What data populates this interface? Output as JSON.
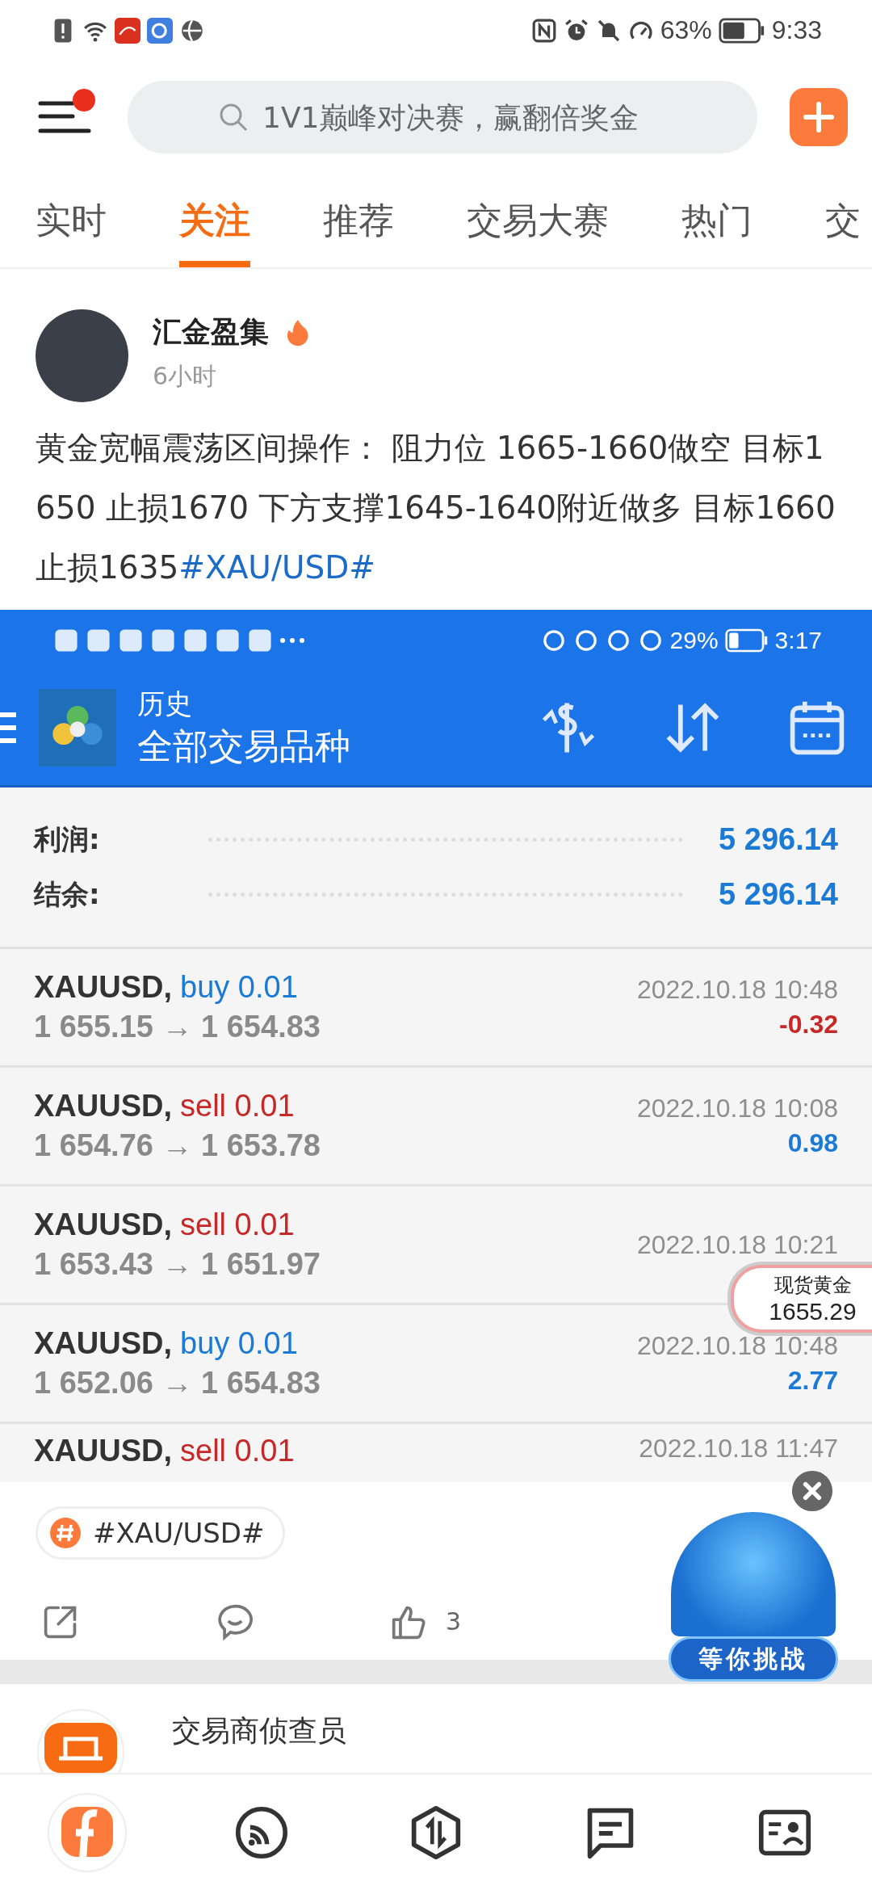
{
  "status_bar": {
    "battery": "63%",
    "time": "9:33"
  },
  "header": {
    "menu_badge": true,
    "search": {
      "placeholder": "1V1巅峰对决赛，赢翻倍奖金"
    }
  },
  "tabs": [
    {
      "label": "实时",
      "selected": false
    },
    {
      "label": "关注",
      "selected": true
    },
    {
      "label": "推荐",
      "selected": false
    },
    {
      "label": "交易大赛",
      "selected": false
    },
    {
      "label": "热门",
      "selected": false
    },
    {
      "label": "交",
      "selected": false
    }
  ],
  "post": {
    "author": "汇金盈集",
    "time": "6小时",
    "text": "黄金宽幅震荡区间操作： 阻力位 1665-1660做空 目标1650 止损1670 下方支撑1645-1640附近做多 目标1660 止损1635",
    "hashtag": "#XAU/USD#",
    "screenshot": {
      "status_bar": {
        "battery": "29%",
        "time": "3:17"
      },
      "toolbar": {
        "title": "历史",
        "subtitle": "全部交易品种"
      },
      "summary": [
        {
          "label": "利润:",
          "value": "5 296.14"
        },
        {
          "label": "结余:",
          "value": "5 296.14"
        }
      ],
      "trades": [
        {
          "symbol": "XAUUSD,",
          "kind": "buy",
          "order": "buy 0.01",
          "prices": "1 655.15 → 1 654.83",
          "time": "2022.10.18 10:48",
          "profit": "-0.32",
          "color": "#c62828"
        },
        {
          "symbol": "XAUUSD,",
          "kind": "sell",
          "order": "sell 0.01",
          "prices": "1 654.76 → 1 653.78",
          "time": "2022.10.18 10:08",
          "profit": "0.98",
          "color": "#1a7ad6"
        },
        {
          "symbol": "XAUUSD,",
          "kind": "sell",
          "order": "sell 0.01",
          "prices": "1 653.43 → 1 651.97",
          "time": "2022.10.18 10:21"
        },
        {
          "symbol": "XAUUSD,",
          "kind": "buy",
          "order": "buy 0.01",
          "prices": "1 652.06 → 1 654.83",
          "time": "2022.10.18 10:48",
          "profit": "2.77",
          "color": "#1a7ad6"
        },
        {
          "symbol": "XAUUSD,",
          "kind": "sell",
          "order": "sell 0.01",
          "time": "2022.10.18 11:47"
        }
      ]
    },
    "tag": "#XAU/USD#",
    "likes": "3"
  },
  "price_bubble": {
    "label": "现货黄金",
    "price": "1655.29"
  },
  "promo": {
    "label": "等你挑战"
  },
  "next_post": {
    "author": "交易商侦查员"
  },
  "bottom_nav": [
    {
      "kind": "home",
      "selected": true
    },
    {
      "kind": "feed",
      "selected": false
    },
    {
      "kind": "trade",
      "selected": false
    },
    {
      "kind": "messages",
      "selected": false
    },
    {
      "kind": "profile",
      "selected": false
    }
  ]
}
